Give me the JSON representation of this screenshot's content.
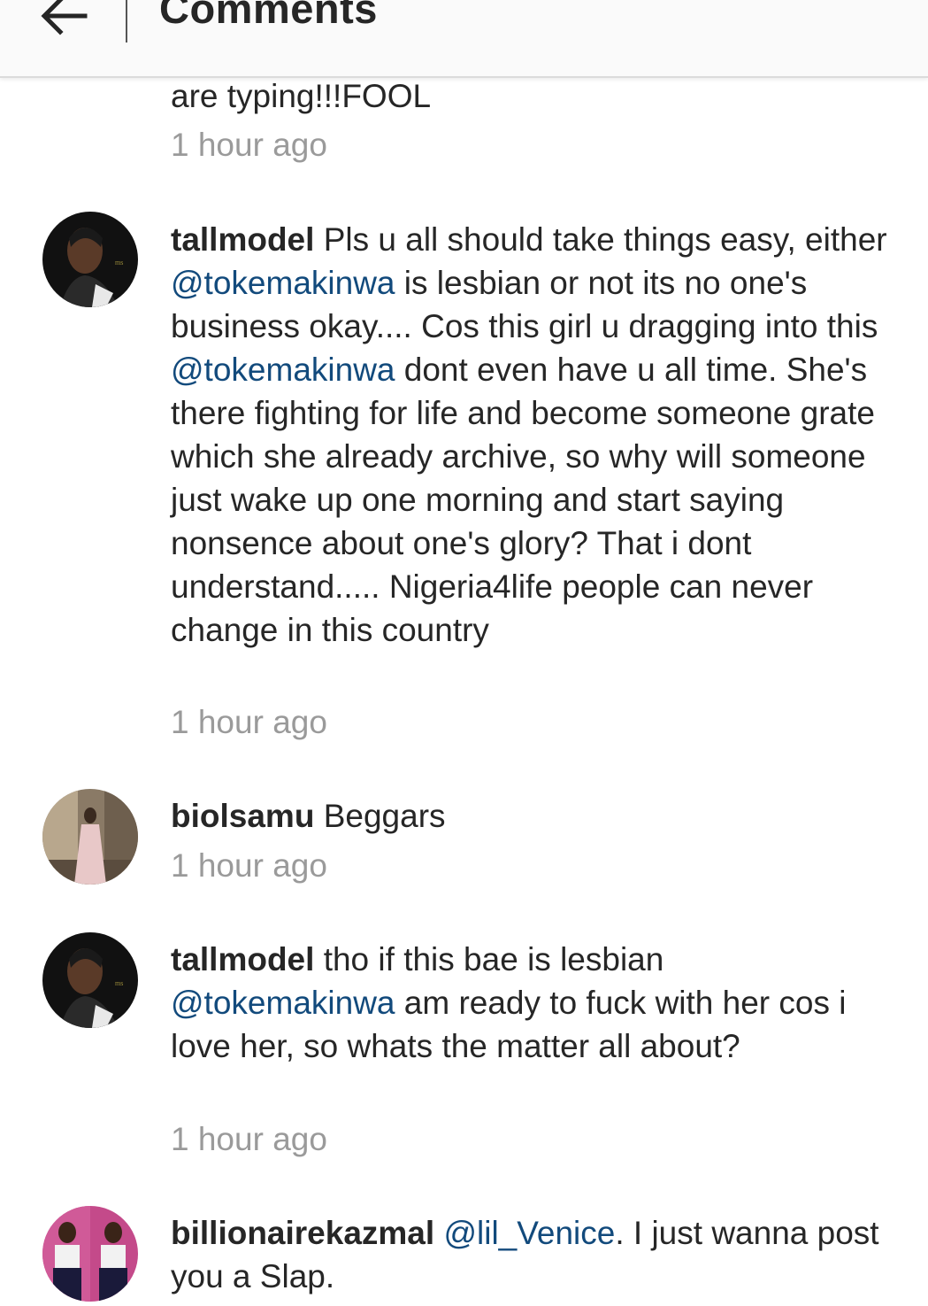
{
  "header": {
    "title": "Comments"
  },
  "comments": [
    {
      "text_end": "are typing!!!FOOL",
      "time": "1 hour ago"
    },
    {
      "username": "tallmodel",
      "t1": " Pls u all should take things easy, either ",
      "m1": "@tokemakinwa",
      "t2": " is lesbian or not its no one's business okay.... Cos this girl u dragging into this ",
      "m2": "@tokemakinwa",
      "t3": " dont even have u all time.  She's there fighting for life and become someone grate which she already archive,  so why will someone just wake up one morning and start saying nonsence about one's glory? That i dont understand..... Nigeria4life people can never change in this country",
      "time": "1 hour ago"
    },
    {
      "username": "biolsamu",
      "t1": " Beggars",
      "time": "1 hour ago"
    },
    {
      "username": "tallmodel",
      "t1": " tho if this bae is lesbian ",
      "m1": "@tokemakinwa",
      "t2": " am ready to fuck with her cos i love her,  so whats the matter all about?",
      "time": "1 hour ago"
    },
    {
      "username": "billionairekazmal",
      "t1": " ",
      "m1": "@lil_Venice",
      "t2": ". I just wanna post you a Slap."
    }
  ],
  "icons": {
    "back": "arrow-left-icon"
  }
}
